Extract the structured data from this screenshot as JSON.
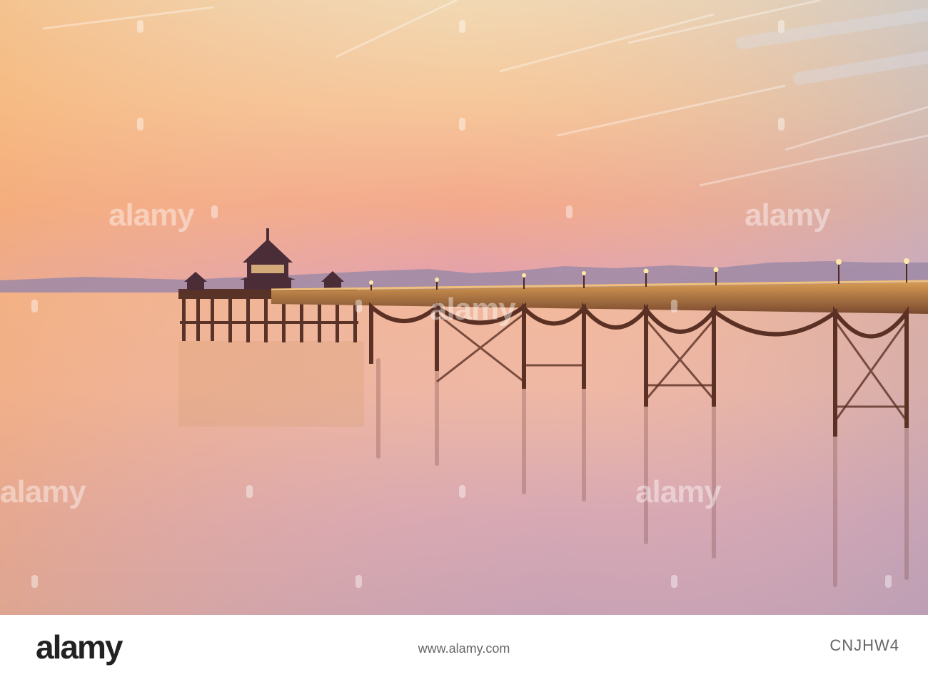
{
  "watermark": {
    "text": "alamy"
  },
  "footer": {
    "logo": "alamy",
    "image_id": "CNJHW4",
    "url": "www.alamy.com"
  }
}
